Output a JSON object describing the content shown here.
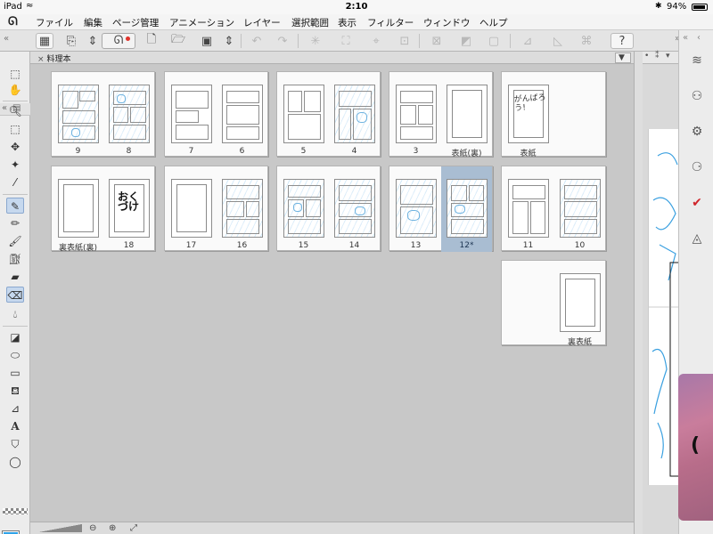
{
  "status_bar": {
    "device": "iPad",
    "time": "2:10",
    "battery": "94%"
  },
  "menu": {
    "items": [
      "ファイル",
      "編集",
      "ページ管理",
      "アニメーション",
      "レイヤー",
      "選択範囲",
      "表示",
      "フィルター",
      "ウィンドウ",
      "ヘルプ"
    ]
  },
  "document": {
    "tab_name": "料理本",
    "tab_close": "×",
    "spreads": [
      {
        "pages": [
          {
            "label": "9",
            "kind": "sketch"
          },
          {
            "label": "8",
            "kind": "sketch"
          }
        ]
      },
      {
        "pages": [
          {
            "label": "7",
            "kind": "gray"
          },
          {
            "label": "6",
            "kind": "gray"
          }
        ]
      },
      {
        "pages": [
          {
            "label": "5",
            "kind": "gray"
          },
          {
            "label": "4",
            "kind": "sketch"
          }
        ]
      },
      {
        "pages": [
          {
            "label": "3",
            "kind": "gray"
          },
          {
            "label": "表紙(裏)",
            "kind": "blank"
          }
        ]
      },
      {
        "pages": [
          {
            "label": "表紙",
            "kind": "title"
          }
        ]
      },
      {
        "pages": [
          {
            "label": "裏表紙(裏)",
            "kind": "blank"
          },
          {
            "label": "18",
            "kind": "hand"
          }
        ]
      },
      {
        "pages": [
          {
            "label": "17",
            "kind": "blank"
          },
          {
            "label": "16",
            "kind": "sketch"
          }
        ]
      },
      {
        "pages": [
          {
            "label": "15",
            "kind": "sketch"
          },
          {
            "label": "14",
            "kind": "sketch"
          }
        ]
      },
      {
        "pages": [
          {
            "label": "13",
            "kind": "sketch"
          },
          {
            "label": "12*",
            "kind": "sketch",
            "selected": true
          }
        ]
      },
      {
        "pages": [
          {
            "label": "11",
            "kind": "gray"
          },
          {
            "label": "10",
            "kind": "sketch"
          }
        ]
      },
      {
        "pages": [
          {
            "label": "裏表紙",
            "kind": "blank"
          }
        ]
      }
    ],
    "page_title_text": "がんばろう!",
    "page_18_text": "おくづけ"
  },
  "icons": {
    "left_tools": [
      "selection-icon",
      "hand-icon",
      "zoom-icon",
      "move-icon",
      "operation-icon",
      "magic-wand-icon",
      "eyedropper-icon",
      "pen-icon",
      "pencil-icon",
      "brush-icon",
      "airbrush-icon",
      "decoration-icon",
      "eraser-icon",
      "blend-icon",
      "fill-icon",
      "gradient-icon",
      "figure-icon",
      "frame-icon",
      "ruler-icon",
      "text-icon",
      "balloon-icon",
      "bucket-icon"
    ],
    "right_tools": [
      "layers-icon",
      "sub-tool-icon",
      "tool-property-icon",
      "brush-size-icon",
      "color-icon",
      "material-icon"
    ]
  },
  "colors": {
    "main_color": "#2ea2e8",
    "sub_color": "#9fe65f",
    "selected_page_bg": "#a9bdd2",
    "sketch_line": "#6fb3e0"
  }
}
